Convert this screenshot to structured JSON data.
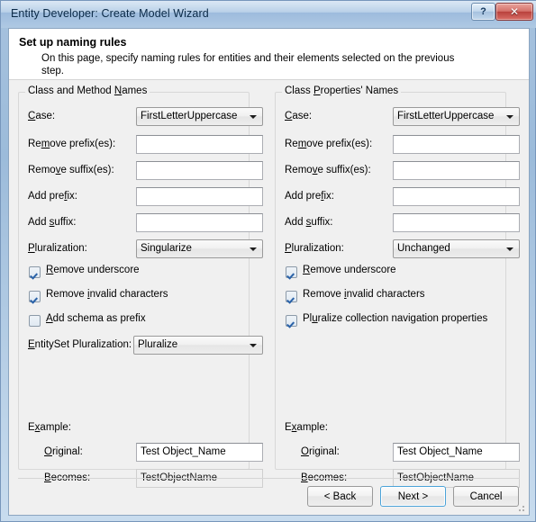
{
  "window": {
    "title": "Entity Developer: Create Model Wizard",
    "help_button": "?",
    "close_button": "✕"
  },
  "header": {
    "title": "Set up naming rules",
    "description": "On this page, specify naming rules for entities and their elements selected on the previous step."
  },
  "left_group": {
    "title_pre": "Class and Method ",
    "title_accel": "N",
    "title_post": "ames",
    "case": {
      "label_pre": "",
      "label_accel": "C",
      "label_post": "ase:",
      "value": "FirstLetterUppercase"
    },
    "remove_prefix": {
      "label_pre": "Re",
      "label_accel": "m",
      "label_post": "ove prefix(es):",
      "value": ""
    },
    "remove_suffix": {
      "label_pre": "Remo",
      "label_accel": "v",
      "label_post": "e suffix(es):",
      "value": ""
    },
    "add_prefix": {
      "label_pre": "Add pre",
      "label_accel": "f",
      "label_post": "ix:",
      "value": ""
    },
    "add_suffix": {
      "label_pre": "Add ",
      "label_accel": "s",
      "label_post": "uffix:",
      "value": ""
    },
    "pluralization": {
      "label_pre": "",
      "label_accel": "P",
      "label_post": "luralization:",
      "value": "Singularize"
    },
    "remove_underscore": {
      "label_pre": "",
      "label_accel": "R",
      "label_post": "emove underscore",
      "checked": true
    },
    "remove_invalid": {
      "label_pre": "Remove ",
      "label_accel": "i",
      "label_post": "nvalid characters",
      "checked": true
    },
    "add_schema_prefix": {
      "label_pre": "",
      "label_accel": "A",
      "label_post": "dd schema as prefix",
      "checked": false
    },
    "entityset_pluralization": {
      "label_pre": "",
      "label_accel": "E",
      "label_post": "ntitySet Pluralization:",
      "value": "Pluralize"
    },
    "example_label": {
      "label_pre": "E",
      "label_accel": "x",
      "label_post": "ample:"
    },
    "original": {
      "label_pre": "",
      "label_accel": "O",
      "label_post": "riginal:",
      "value": "Test Object_Name"
    },
    "becomes": {
      "label_pre": "",
      "label_accel": "B",
      "label_post": "ecomes:",
      "value": "TestObjectName"
    }
  },
  "right_group": {
    "title_pre": "Class ",
    "title_accel": "P",
    "title_post": "roperties' Names",
    "case": {
      "label_pre": "",
      "label_accel": "C",
      "label_post": "ase:",
      "value": "FirstLetterUppercase"
    },
    "remove_prefix": {
      "label_pre": "Re",
      "label_accel": "m",
      "label_post": "ove prefix(es):",
      "value": ""
    },
    "remove_suffix": {
      "label_pre": "Remo",
      "label_accel": "v",
      "label_post": "e suffix(es):",
      "value": ""
    },
    "add_prefix": {
      "label_pre": "Add pre",
      "label_accel": "f",
      "label_post": "ix:",
      "value": ""
    },
    "add_suffix": {
      "label_pre": "Add ",
      "label_accel": "s",
      "label_post": "uffix:",
      "value": ""
    },
    "pluralization": {
      "label_pre": "",
      "label_accel": "P",
      "label_post": "luralization:",
      "value": "Unchanged"
    },
    "remove_underscore": {
      "label_pre": "",
      "label_accel": "R",
      "label_post": "emove underscore",
      "checked": true
    },
    "remove_invalid": {
      "label_pre": "Remove ",
      "label_accel": "i",
      "label_post": "nvalid characters",
      "checked": true
    },
    "pluralize_nav": {
      "label_pre": "Pl",
      "label_accel": "u",
      "label_post": "ralize  collection  navigation  properties",
      "checked": true
    },
    "example_label": {
      "label_pre": "E",
      "label_accel": "x",
      "label_post": "ample:"
    },
    "original": {
      "label_pre": "",
      "label_accel": "O",
      "label_post": "riginal:",
      "value": "Test Object_Name"
    },
    "becomes": {
      "label_pre": "",
      "label_accel": "B",
      "label_post": "ecomes:",
      "value": "TestObjectName"
    }
  },
  "footer": {
    "back": "< Back",
    "next": "Next >",
    "cancel": "Cancel"
  },
  "colors": {
    "accent": "#4ba3d8",
    "dialog_bg": "#f0f0f0",
    "header_bg": "#ffffff",
    "title_text": "#0b2a47",
    "close_button": "#b8403c"
  }
}
